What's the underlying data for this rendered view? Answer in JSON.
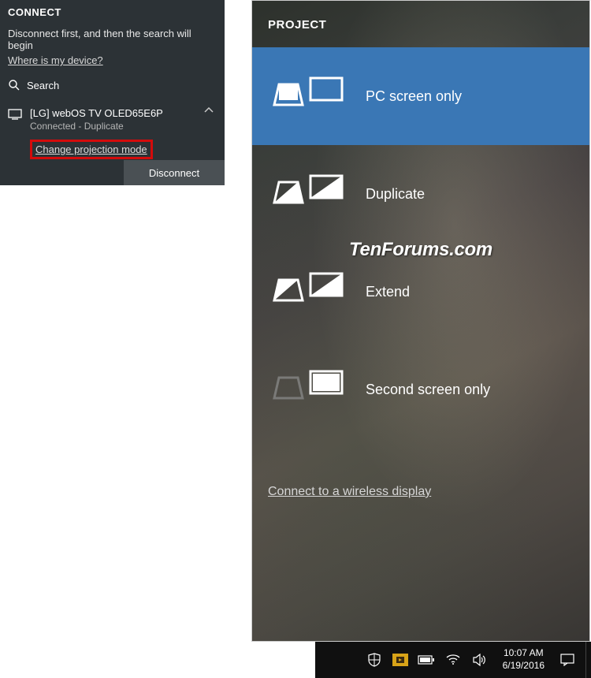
{
  "connect": {
    "title": "CONNECT",
    "instruction": "Disconnect first, and then the search will begin",
    "where_link": "Where is my device?",
    "search_label": "Search",
    "device": {
      "name": "[LG] webOS TV OLED65E6P",
      "status": "Connected - Duplicate"
    },
    "change_proj_label": "Change projection mode",
    "disconnect_label": "Disconnect"
  },
  "project": {
    "title": "PROJECT",
    "items": [
      {
        "label": "PC screen only",
        "selected": true,
        "mode": "pc-only"
      },
      {
        "label": "Duplicate",
        "selected": false,
        "mode": "duplicate"
      },
      {
        "label": "Extend",
        "selected": false,
        "mode": "extend"
      },
      {
        "label": "Second screen only",
        "selected": false,
        "mode": "second-only"
      }
    ],
    "wireless_link": "Connect to a wireless display"
  },
  "watermark": "TenForums.com",
  "taskbar": {
    "time": "10:07 AM",
    "date": "6/19/2016"
  }
}
